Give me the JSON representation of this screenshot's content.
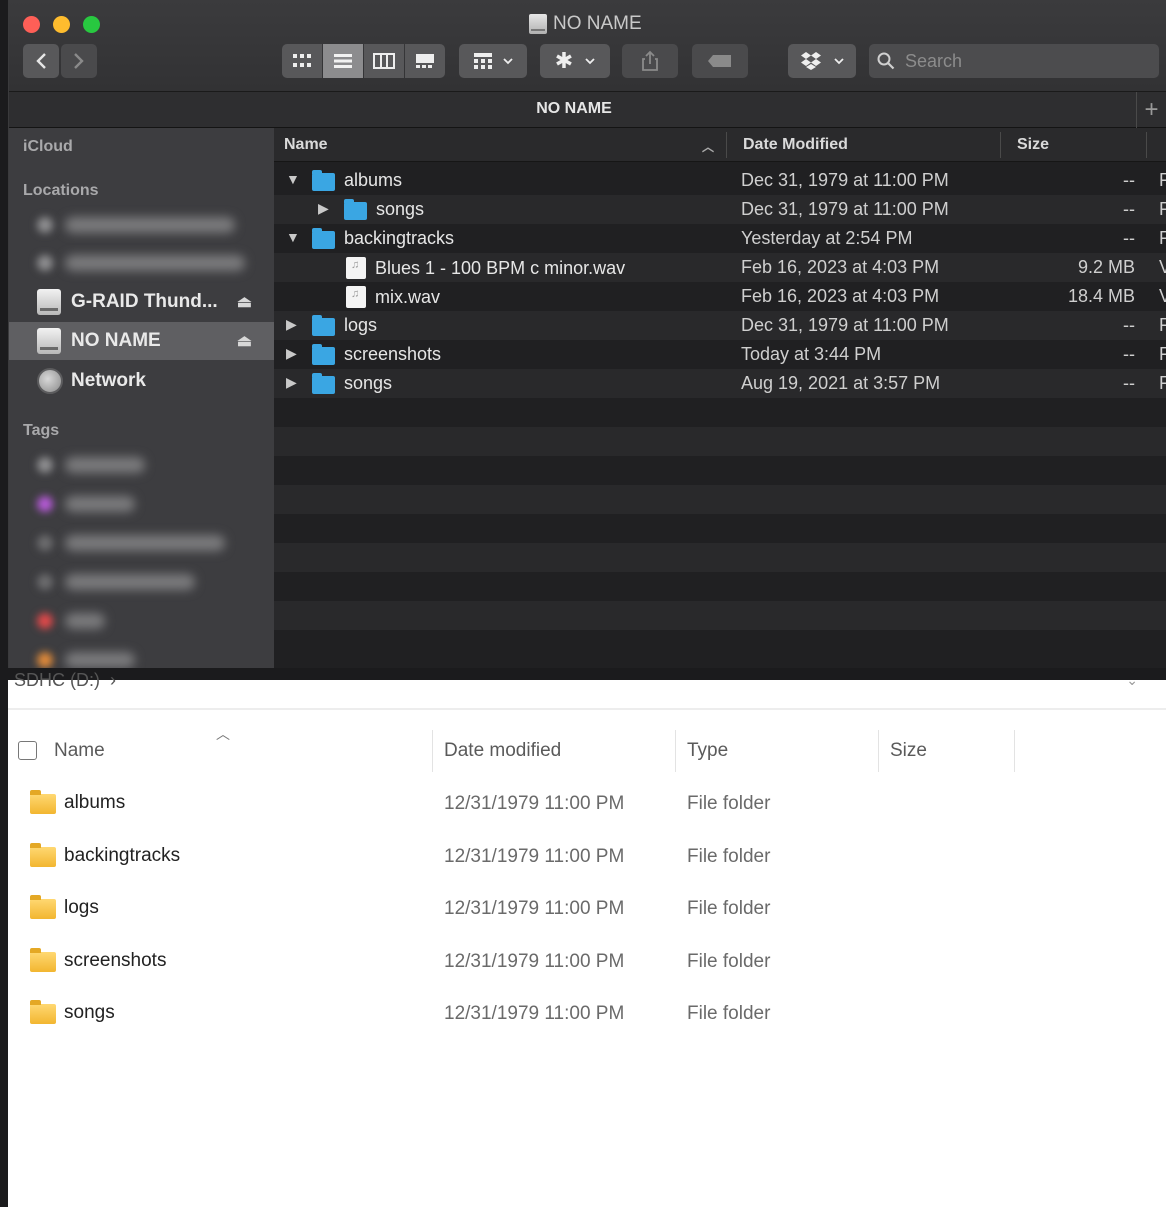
{
  "mac_finder": {
    "window_title": "NO NAME",
    "path_title": "NO NAME",
    "traffic_lights": {
      "close": "#fe5f57",
      "minimize": "#febc2e",
      "zoom": "#28c840"
    },
    "toolbar": {
      "back_icon": "chevron-left-icon",
      "forward_icon": "chevron-right-icon",
      "view_modes": [
        "icon-view-icon",
        "list-view-icon",
        "column-view-icon",
        "gallery-view-icon"
      ],
      "active_view": "list-view-icon",
      "group_icon": "group-by-icon",
      "action_icon": "gear-icon",
      "share_icon": "share-icon",
      "tag_icon": "tag-icon",
      "dropbox_icon": "dropbox-icon",
      "search_placeholder": "Search",
      "add_tab": "+"
    },
    "sidebar": {
      "sections": {
        "icloud": "iCloud",
        "locations": "Locations",
        "tags": "Tags"
      },
      "locations": [
        {
          "label": "G-RAID Thund...",
          "icon": "external-drive-icon",
          "ejectable": true
        },
        {
          "label": "NO NAME",
          "icon": "external-drive-icon",
          "ejectable": true,
          "selected": true
        },
        {
          "label": "Network",
          "icon": "network-globe-icon"
        }
      ],
      "tag_colors": [
        "#9a9a9a",
        "#b55ad6",
        "#9a9a9a",
        "#9a9a9a",
        "#e0494a",
        "#e08a3a"
      ]
    },
    "columns": {
      "name": "Name",
      "date": "Date Modified",
      "size": "Size"
    },
    "rows": [
      {
        "name": "albums",
        "date": "Dec 31, 1979 at 11:00 PM",
        "size": "--",
        "kind": "F",
        "type": "folder",
        "indent": 0,
        "disclosure": "expanded"
      },
      {
        "name": "songs",
        "date": "Dec 31, 1979 at 11:00 PM",
        "size": "--",
        "kind": "F",
        "type": "folder",
        "indent": 1,
        "disclosure": "collapsed"
      },
      {
        "name": "backingtracks",
        "date": "Yesterday at 2:54 PM",
        "size": "--",
        "kind": "F",
        "type": "folder",
        "indent": 0,
        "disclosure": "expanded"
      },
      {
        "name": "Blues 1 - 100 BPM c minor.wav",
        "date": "Feb 16, 2023 at 4:03 PM",
        "size": "9.2 MB",
        "kind": "V",
        "type": "file",
        "indent": 1,
        "disclosure": "none"
      },
      {
        "name": "mix.wav",
        "date": "Feb 16, 2023 at 4:03 PM",
        "size": "18.4 MB",
        "kind": "V",
        "type": "file",
        "indent": 1,
        "disclosure": "none"
      },
      {
        "name": "logs",
        "date": "Dec 31, 1979 at 11:00 PM",
        "size": "--",
        "kind": "F",
        "type": "folder",
        "indent": 0,
        "disclosure": "collapsed"
      },
      {
        "name": "screenshots",
        "date": "Today at 3:44 PM",
        "size": "--",
        "kind": "F",
        "type": "folder",
        "indent": 0,
        "disclosure": "collapsed"
      },
      {
        "name": "songs",
        "date": "Aug 19, 2021 at 3:57 PM",
        "size": "--",
        "kind": "F",
        "type": "folder",
        "indent": 0,
        "disclosure": "collapsed"
      }
    ]
  },
  "windows_explorer": {
    "breadcrumb": "SDHC (D:)",
    "breadcrumb_chevron": "›",
    "columns": {
      "name": "Name",
      "date": "Date modified",
      "type": "Type",
      "size": "Size"
    },
    "rows": [
      {
        "name": "albums",
        "date": "12/31/1979 11:00 PM",
        "type": "File folder"
      },
      {
        "name": "backingtracks",
        "date": "12/31/1979 11:00 PM",
        "type": "File folder"
      },
      {
        "name": "logs",
        "date": "12/31/1979 11:00 PM",
        "type": "File folder"
      },
      {
        "name": "screenshots",
        "date": "12/31/1979 11:00 PM",
        "type": "File folder"
      },
      {
        "name": "songs",
        "date": "12/31/1979 11:00 PM",
        "type": "File folder"
      }
    ]
  }
}
